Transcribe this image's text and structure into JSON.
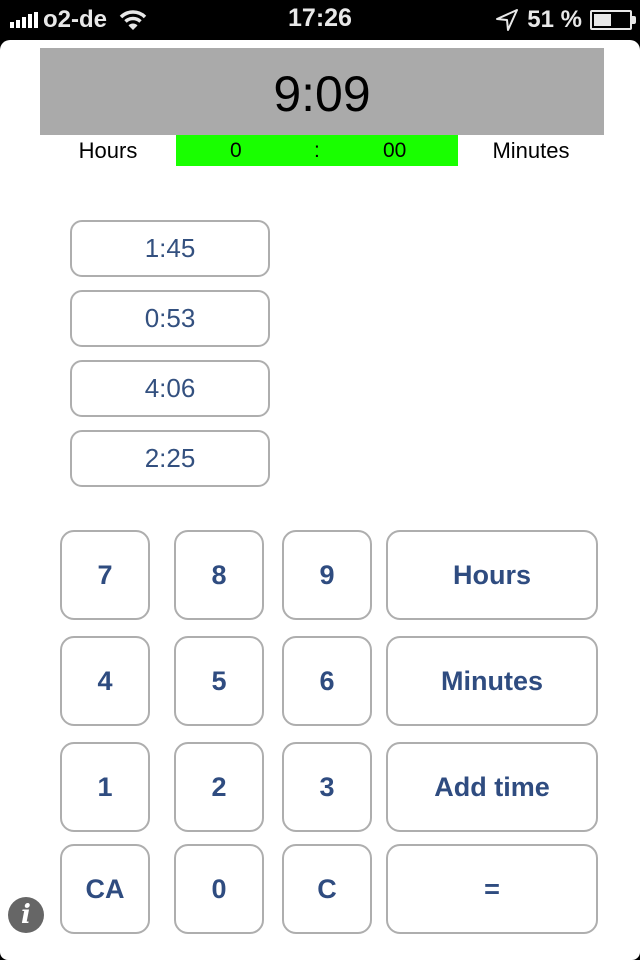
{
  "status_bar": {
    "carrier": "o2-de",
    "time": "17:26",
    "battery_percent": "51 %",
    "battery_level": 0.51,
    "icons": [
      "signal-icon",
      "wifi-icon",
      "location-icon",
      "battery-icon"
    ]
  },
  "display": {
    "result": "9:09"
  },
  "input": {
    "hours_label": "Hours",
    "hours_value": "0",
    "separator": ":",
    "minutes_value": "00",
    "minutes_label": "Minutes",
    "highlight_color": "#19ff00"
  },
  "history": [
    {
      "value": "1:45"
    },
    {
      "value": "0:53"
    },
    {
      "value": "4:06"
    },
    {
      "value": "2:25"
    }
  ],
  "keypad": {
    "k7": "7",
    "k8": "8",
    "k9": "9",
    "hours": "Hours",
    "k4": "4",
    "k5": "5",
    "k6": "6",
    "minutes": "Minutes",
    "k1": "1",
    "k2": "2",
    "k3": "3",
    "add_time": "Add time",
    "ca": "CA",
    "k0": "0",
    "c": "C",
    "equals": "="
  },
  "info": {
    "glyph": "i"
  },
  "colors": {
    "button_text": "#2f4c80",
    "display_bg": "#aaaaaa"
  }
}
